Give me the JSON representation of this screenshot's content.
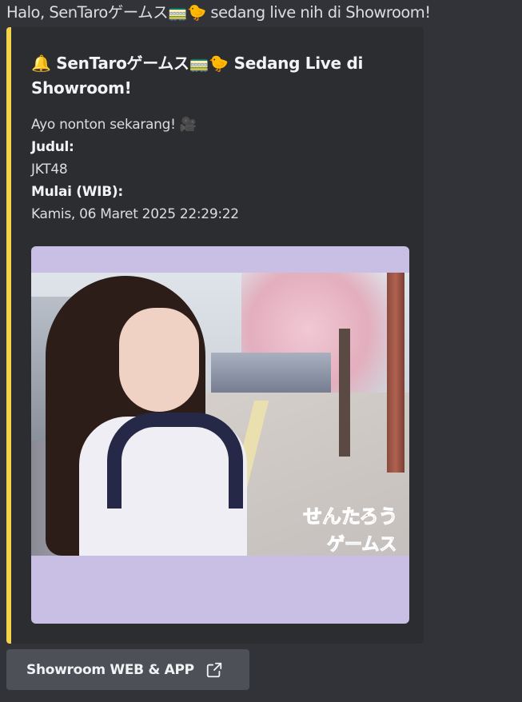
{
  "message": {
    "text": "Halo, SenTaroゲームス🚃🐤 sedang live nih di Showroom!"
  },
  "embed": {
    "accent_color": "#f3d34a",
    "title": "🔔 SenTaroゲームス🚃🐤 Sedang Live di Showroom!",
    "description": "Ayo nonton sekarang! 🎥",
    "fields": [
      {
        "label": "Judul:",
        "value": "JKT48"
      },
      {
        "label": "Mulai (WIB):",
        "value": "Kamis, 06 Maret 2025 22:29:22"
      }
    ],
    "image": {
      "background_color": "#c9bee3",
      "overlay_text_1": "せんたろう",
      "overlay_text_2": "ゲームス"
    }
  },
  "button": {
    "label": "Showroom WEB & APP",
    "icon": "external-link-icon"
  }
}
